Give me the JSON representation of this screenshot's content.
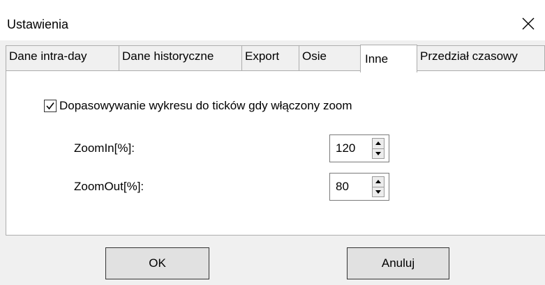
{
  "window": {
    "title": "Ustawienia",
    "close_icon": "close-icon"
  },
  "tabs": [
    {
      "label": "Dane intra-day",
      "active": false
    },
    {
      "label": "Dane historyczne",
      "active": false
    },
    {
      "label": "Export",
      "active": false
    },
    {
      "label": "Osie",
      "active": false
    },
    {
      "label": "Inne",
      "active": true
    },
    {
      "label": "Przedział czasowy",
      "active": false
    }
  ],
  "inne": {
    "fit_to_ticks": {
      "label": "Dopasowywanie wykresu do ticków gdy włączony zoom",
      "checked": true
    },
    "zoom_in": {
      "label": "ZoomIn[%]:",
      "value": "120"
    },
    "zoom_out": {
      "label": "ZoomOut[%]:",
      "value": "80"
    }
  },
  "buttons": {
    "ok": "OK",
    "cancel": "Anuluj"
  }
}
